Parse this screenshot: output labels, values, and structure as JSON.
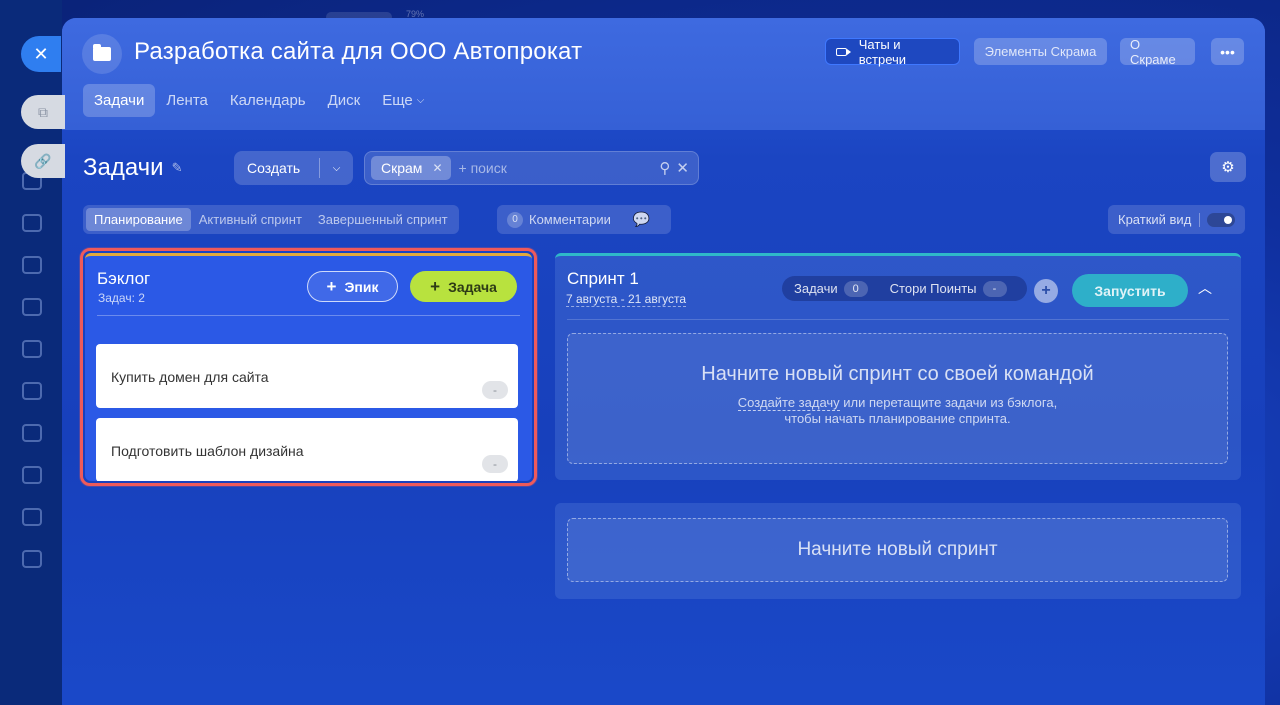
{
  "background": {
    "top_indicator": "79%"
  },
  "window": {
    "close_glyph": "✕"
  },
  "header": {
    "title": "Разработка сайта для ООО Автопрокат",
    "buttons": {
      "chats": "Чаты и встречи",
      "scrum_elements": "Элементы Скрама",
      "about_scrum": "О Скраме",
      "more": "•••"
    }
  },
  "tabs": [
    {
      "label": "Задачи",
      "active": true
    },
    {
      "label": "Лента"
    },
    {
      "label": "Календарь"
    },
    {
      "label": "Диск"
    },
    {
      "label": "Еще"
    }
  ],
  "toolbar": {
    "page_title": "Задачи",
    "create_label": "Создать",
    "filter_chip": "Скрам",
    "search_placeholder": "+ поиск"
  },
  "subtabs": [
    {
      "label": "Планирование",
      "active": true
    },
    {
      "label": "Активный спринт"
    },
    {
      "label": "Завершенный спринт"
    }
  ],
  "comments": {
    "count": "0",
    "label": "Комментарии"
  },
  "brief_view": {
    "label": "Краткий вид",
    "enabled": true
  },
  "backlog": {
    "title": "Бэклог",
    "count_label": "Задач: 2",
    "epic_button": "Эпик",
    "task_button": "Задача",
    "items": [
      {
        "name": "Купить домен для сайта",
        "points": "-"
      },
      {
        "name": "Подготовить шаблон дизайна",
        "points": "-"
      }
    ]
  },
  "sprint": {
    "title": "Спринт 1",
    "dates": "7 августа - 21 августа",
    "tasks_label": "Задачи",
    "tasks_count": "0",
    "story_points_label": "Стори Поинты",
    "story_points_value": "-",
    "launch_button": "Запустить",
    "empty_heading": "Начните новый спринт со своей командой",
    "empty_link": "Создайте задачу",
    "empty_text_1": " или перетащите задачи из бэклога,",
    "empty_text_2": "чтобы начать планирование спринта."
  },
  "new_sprint": {
    "label": "Начните новый спринт"
  },
  "colors": {
    "accent_green": "#b8e23e",
    "highlight_red": "#ef5a5a",
    "sprint_teal": "#2eafc9",
    "backlog_blue": "#2b59e6"
  }
}
